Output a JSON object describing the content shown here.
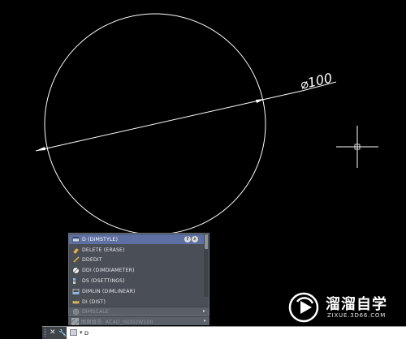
{
  "drawing": {
    "dimension_text": "⌀100"
  },
  "autocomplete": {
    "items": [
      {
        "label": "D (DIMSTYLE)",
        "icon": "dimstyle-icon",
        "selected": true
      },
      {
        "label": "DELETE (ERASE)",
        "icon": "eraser-icon",
        "selected": false
      },
      {
        "label": "DDEDIT",
        "icon": "text-edit-icon",
        "selected": false
      },
      {
        "label": "DDI (DIMDIAMETER)",
        "icon": "diameter-icon",
        "selected": false
      },
      {
        "label": "DS (DSETTINGS)",
        "icon": "settings-icon",
        "selected": false
      },
      {
        "label": "DIMLIN (DIMLINEAR)",
        "icon": "linear-dim-icon",
        "selected": false
      },
      {
        "label": "DI (DIST)",
        "icon": "measure-icon",
        "selected": false
      }
    ],
    "system_variable": "DIMSCALE",
    "preset": "图面填充: ACAD_ISO02W100"
  },
  "command_line": {
    "input_value": "D"
  },
  "watermark": {
    "brand": "溜溜自学",
    "url": "ZIXUE.3D66.COM"
  },
  "colors": {
    "canvas": "#000000",
    "annotation_arrow": "#e3211c"
  }
}
